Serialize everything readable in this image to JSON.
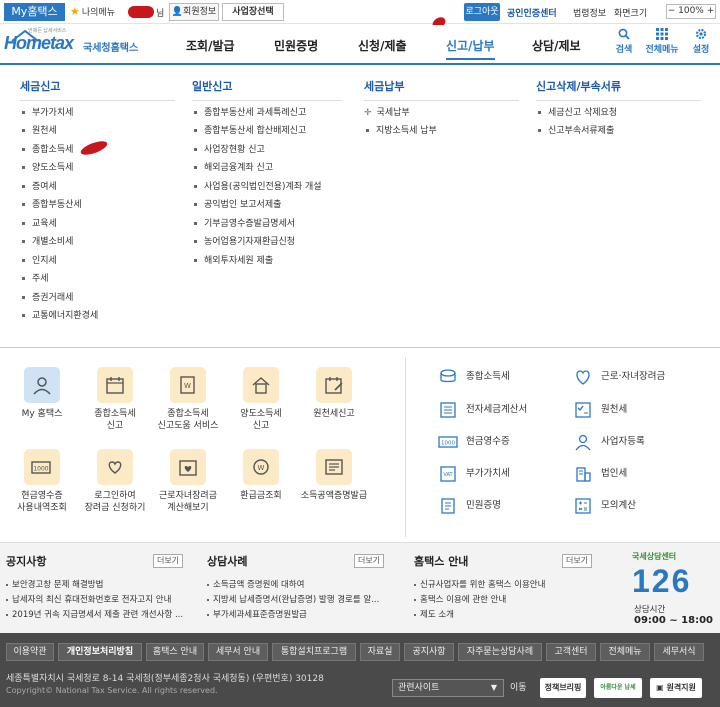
{
  "topbar": {
    "my_hometax": "My홈택스",
    "my_menu": "나의메뉴",
    "name_suffix": "님",
    "member_info": "회원정보",
    "business_select": "사업장선택",
    "logout": "로그아웃",
    "cert_center": "공인인증센터",
    "law_info": "법령정보",
    "screen_size": "화면크기",
    "zoom": "100%"
  },
  "header": {
    "logo_tagline": "언제든 납세서비스",
    "logo_text": "Hometax",
    "logo_kr": "국세청홈택스",
    "nav": [
      "조회/발급",
      "민원증명",
      "신청/제출",
      "신고/납부",
      "상담/제보"
    ],
    "icons": [
      "검색",
      "전체메뉴",
      "설정"
    ]
  },
  "megamenu": {
    "columns": [
      {
        "title": "세금신고",
        "items": [
          "부가가치세",
          "원천세",
          "종합소득세",
          "양도소득세",
          "증여세",
          "종합부동산세",
          "교육세",
          "개별소비세",
          "인지세",
          "주세",
          "증권거래세",
          "교통에너지환경세"
        ]
      },
      {
        "title": "일반신고",
        "items": [
          "종합부동산세 과세특례신고",
          "종합부동산세 합산배제신고",
          "사업장현황 신고",
          "해외금융계좌 신고",
          "사업용(공익법인전용)계좌 개설",
          "공익법인 보고서제출",
          "기부금영수증발급명세서",
          "농어업용기자재환급신청",
          "해외투자세원 제출"
        ]
      },
      {
        "title": "세금납부",
        "items": [
          "국세납부",
          "지방소득세 납부"
        ]
      },
      {
        "title": "신고삭제/부속서류",
        "items": [
          "세금신고 삭제요청",
          "신고부속서류제출"
        ]
      }
    ]
  },
  "quick": {
    "boxes": [
      [
        "My 홈택스"
      ],
      [
        "종합소득세",
        "신고"
      ],
      [
        "종합소득세",
        "신고도움 서비스"
      ],
      [
        "양도소득세",
        "신고"
      ],
      [
        "원천세신고"
      ],
      [
        "현금영수증",
        "사용내역조회"
      ],
      [
        "로그인하여",
        "장려금 신청하기"
      ],
      [
        "근로자녀장려금",
        "계산해보기"
      ],
      [
        "환급금조회"
      ],
      [
        "소득공액증명발급"
      ]
    ],
    "right_items": [
      "종합소득세",
      "근로·자녀장려금",
      "전자세금계산서",
      "원천세",
      "현금영수증",
      "사업자등록",
      "부가가치세",
      "법인세",
      "민원증명",
      "모의계산"
    ]
  },
  "news": {
    "notice": {
      "title": "공지사항",
      "more": "더보기",
      "items": [
        "보안경고창 문제 해결방법",
        "납세자의 최신 휴대전화번호로 전자고지 안내",
        "2019년 귀속 지급명세서 제출 관련 개선사항 ..."
      ]
    },
    "cases": {
      "title": "상담사례",
      "more": "더보기",
      "items": [
        "소득금액 증명원에 대하여",
        "지방세 납세증명서(완납증명) 발행 경로를 알...",
        "부가세과세표준증명원발급"
      ]
    },
    "guide": {
      "title": "홈택스 안내",
      "more": "더보기",
      "items": [
        "신규사업자를 위한 홈택스 이용안내",
        "홈택스 이용에 관한 안내",
        "제도 소개"
      ]
    },
    "center": {
      "tag": "국세상담센터",
      "number": "126",
      "hours_label": "상담시간",
      "hours": "09:00 ~ 18:00"
    }
  },
  "footer": {
    "links": [
      "이용약관",
      "개인정보처리방침",
      "홈택스 안내",
      "세무서 안내",
      "통합설치프로그램",
      "자료실",
      "공지사항",
      "자주묻는상담사례",
      "고객센터",
      "전체메뉴",
      "세무서식"
    ],
    "address": "세종특별자치시 국세청로 8-14 국세청(정부세종2청사 국세청동) (우편번호) 30128",
    "copyright": "Copyright© National Tax Service. All rights reserved.",
    "site_select": "관련사이트",
    "go": "이동",
    "badges": [
      "정책브리핑",
      "아름다운 납세",
      "원격지원"
    ]
  },
  "colors": {
    "brand_blue": "#2b78c2",
    "highlight_red": "#c8161d",
    "footer_bg": "#4a4a4a"
  }
}
